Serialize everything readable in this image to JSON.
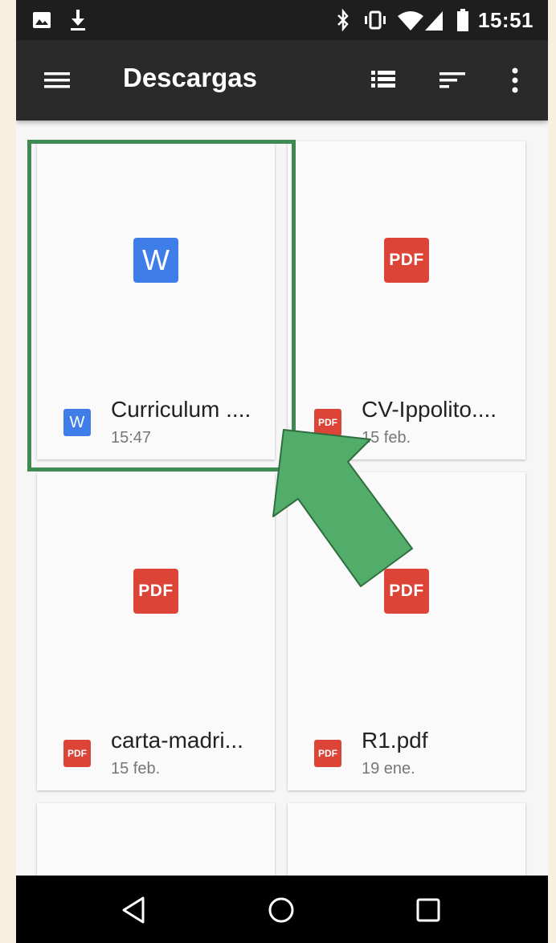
{
  "status_bar": {
    "time": "15:51",
    "left_icons": [
      "image-icon",
      "download-icon"
    ],
    "right_icons": [
      "bluetooth-icon",
      "vibrate-icon",
      "wifi-icon",
      "signal-icon",
      "battery-icon"
    ]
  },
  "toolbar": {
    "title": "Descargas",
    "menu_icon": "menu-icon",
    "actions": [
      "list-view-icon",
      "sort-icon",
      "more-vert-icon"
    ]
  },
  "files": [
    {
      "name": "Curriculum ....",
      "date": "15:47",
      "type": "word",
      "type_label": "W",
      "highlighted": true
    },
    {
      "name": "CV-Ippolito....",
      "date": "15 feb.",
      "type": "pdf",
      "type_label": "PDF"
    },
    {
      "name": "carta-madri...",
      "date": "15 feb.",
      "type": "pdf",
      "type_label": "PDF"
    },
    {
      "name": "R1.pdf",
      "date": "19 ene.",
      "type": "pdf",
      "type_label": "PDF"
    }
  ],
  "colors": {
    "word_blue": "#3f7ee8",
    "pdf_red": "#db4437",
    "highlight_green": "#3e8a52",
    "arrow_green": "#52ad6a"
  },
  "nav_bar": [
    "back-icon",
    "home-icon",
    "recents-icon"
  ]
}
